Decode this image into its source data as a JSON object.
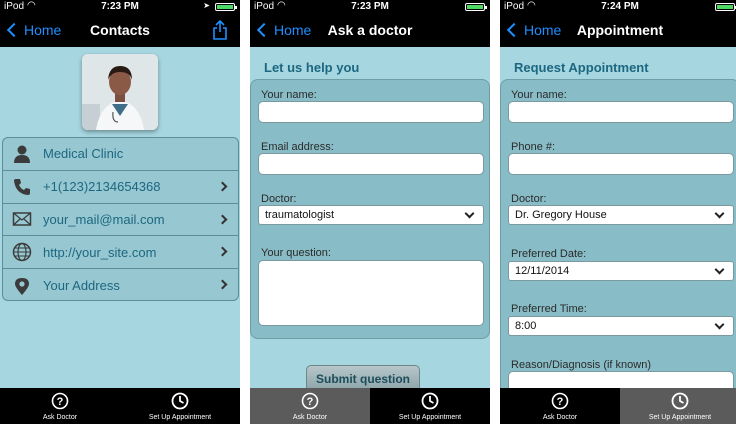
{
  "status": {
    "carrier": "iPod",
    "times": [
      "7:23 PM",
      "7:23 PM",
      "7:24 PM"
    ]
  },
  "nav": {
    "back_label": "Home",
    "titles": [
      "Contacts",
      "Ask a doctor",
      "Appointment"
    ]
  },
  "contacts": {
    "rows": [
      {
        "label": "Medical Clinic",
        "icon": "person-icon"
      },
      {
        "label": "+1(123)2134654368",
        "icon": "phone-icon"
      },
      {
        "label": "your_mail@mail.com",
        "icon": "mail-icon"
      },
      {
        "label": "http://your_site.com",
        "icon": "globe-icon"
      },
      {
        "label": "Your Address",
        "icon": "location-pin-icon"
      }
    ]
  },
  "ask": {
    "heading": "Let us help you",
    "name_label": "Your name:",
    "email_label": "Email address:",
    "doctor_label": "Doctor:",
    "doctor_value": "traumatologist",
    "question_label": "Your question:",
    "submit_label": "Submit question"
  },
  "appointment": {
    "heading": "Request Appointment",
    "name_label": "Your name:",
    "phone_label": "Phone #:",
    "doctor_label": "Doctor:",
    "doctor_value": "Dr. Gregory House",
    "date_label": "Preferred Date:",
    "date_value": "12/11/2014",
    "time_label": "Preferred Time:",
    "time_value": "8:00",
    "reason_label": "Reason/Diagnosis (if known)"
  },
  "tabs": {
    "ask_label": "Ask Doctor",
    "appointment_label": "Set Up Appointment"
  },
  "colors": {
    "accent": "#1e8fff",
    "heading": "#1d6781",
    "background": "#a6d6e0"
  }
}
